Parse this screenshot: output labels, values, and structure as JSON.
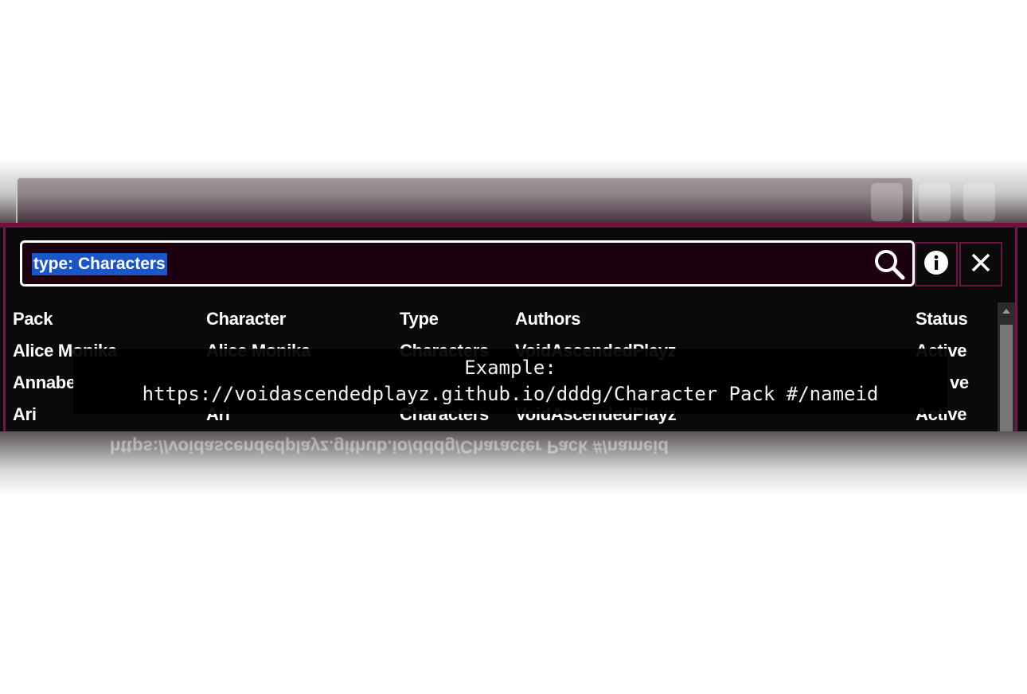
{
  "search": {
    "value": "type: Characters"
  },
  "icons": {
    "search": "search-icon",
    "info": "info-icon",
    "close": "close-icon",
    "scroll_up": "chevron-up-icon"
  },
  "colors": {
    "accent": "#6e1340",
    "panel_bg": "#0a0a0a",
    "search_bg": "#1c0010",
    "selection": "#1a56c8"
  },
  "table": {
    "headers": [
      "Pack",
      "Character",
      "Type",
      "Authors",
      "Status"
    ],
    "rows": [
      [
        "Alice Monika",
        "Alice Monika",
        "Characters",
        "VoidAscendedPlayz",
        "Active"
      ],
      [
        "Annabe",
        "",
        "",
        "",
        "ve"
      ],
      [
        "Ari",
        "Ari",
        "Characters",
        "VoidAscendedPlayz",
        "Active"
      ]
    ]
  },
  "tooltip": {
    "line1": "Example:",
    "line2": "https://voidascendedplayz.github.io/dddg/Character Pack #/nameid"
  }
}
